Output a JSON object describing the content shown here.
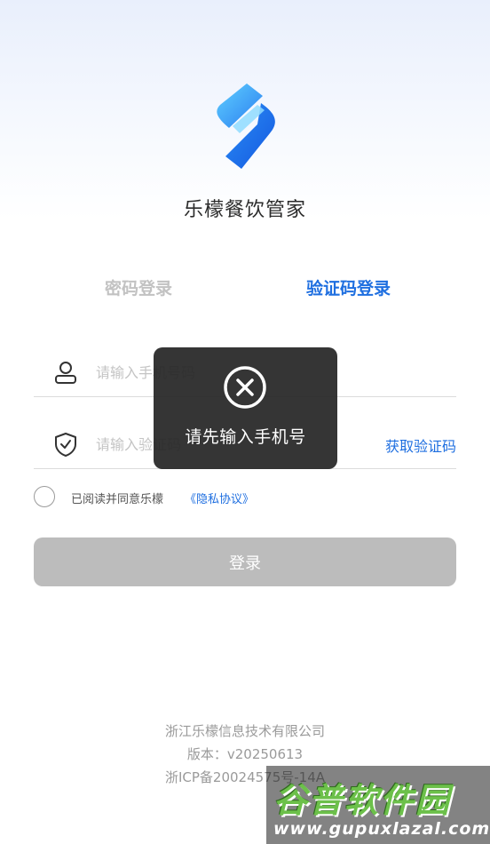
{
  "app": {
    "name": "乐檬餐饮管家"
  },
  "tabs": {
    "password_login": "密码登录",
    "sms_login": "验证码登录"
  },
  "form": {
    "phone_placeholder": "请输入手机号码",
    "code_placeholder": "请输入验证码",
    "get_code_label": "获取验证码",
    "agree_text": "已阅读并同意乐檬",
    "privacy_link": "《隐私协议》",
    "agree_checked": false,
    "login_label": "登录"
  },
  "toast": {
    "message": "请先输入手机号",
    "icon": "close-circle-icon"
  },
  "footer": {
    "company": "浙江乐檬信息技术有限公司",
    "version": "版本：v20250613",
    "icp": "浙ICP备20024575号-14A"
  },
  "watermark": {
    "title": "谷普软件园",
    "url": "www.gupuxlazal.com"
  },
  "colors": {
    "accent": "#1f6fe0",
    "inactive_tab": "#c2c2c2",
    "button_disabled": "#bcbcbc",
    "toast_bg": "#262626"
  }
}
